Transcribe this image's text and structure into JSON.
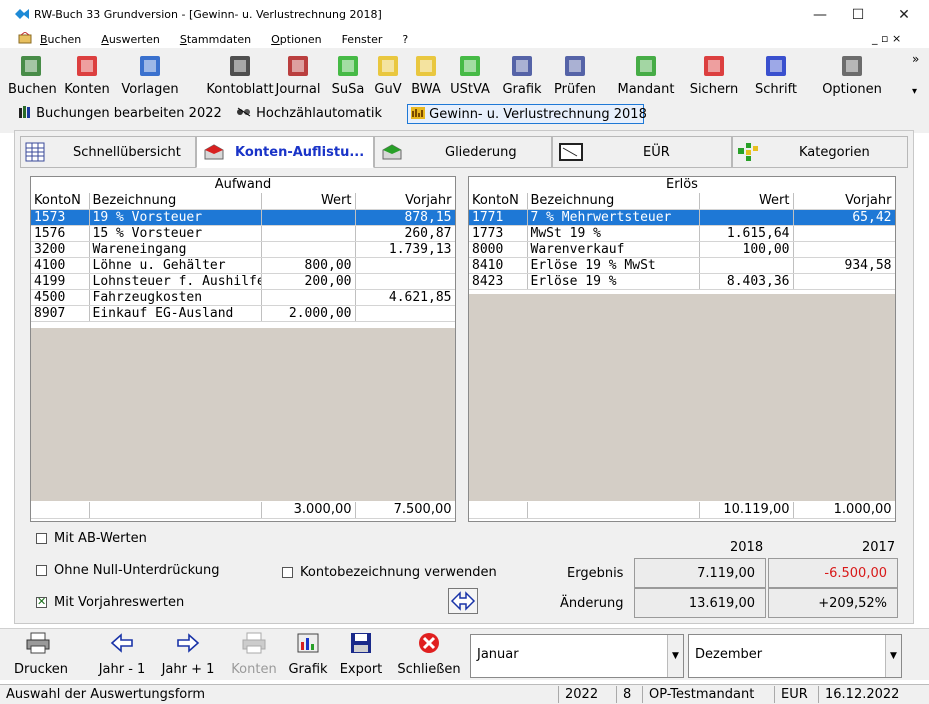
{
  "window": {
    "title": "RW-Buch 33 Grundversion  - [Gewinn- u. Verlustrechnung 2018]",
    "controls": {
      "minimize": "—",
      "maximize": "☐",
      "close": "✕"
    }
  },
  "menu": {
    "items": [
      "Buchen",
      "Auswerten",
      "Stammdaten",
      "Optionen",
      "Fenster",
      "?"
    ],
    "mdi_controls": "_ ▫ ×"
  },
  "toolbar": {
    "buttons": [
      "Buchen",
      "Konten",
      "Vorlagen",
      "Kontoblatt",
      "Journal",
      "SuSa",
      "GuV",
      "BWA",
      "UStVA",
      "Grafik",
      "Prüfen",
      "Mandant",
      "Sichern",
      "Schrift",
      "Optionen"
    ],
    "overflow": "»",
    "overflow_down": "▾"
  },
  "doc_tabs": {
    "items": [
      "Buchungen bearbeiten 2022",
      "Hochzählautomatik",
      "Gewinn- u. Verlustrechnung 2018"
    ],
    "active_index": 2
  },
  "view_tabs": {
    "items": [
      "Schnellübersicht",
      "Konten-Auflistu...",
      "Gliederung",
      "EÜR",
      "Kategorien"
    ],
    "active_index": 1
  },
  "aufwand": {
    "title": "Aufwand",
    "columns": [
      "KontoN",
      "Bezeichnung",
      "Wert",
      "Vorjahr"
    ],
    "rows": [
      [
        "1573",
        "19 % Vorsteuer",
        "",
        "878,15"
      ],
      [
        "1576",
        "15 % Vorsteuer",
        "",
        "260,87"
      ],
      [
        "3200",
        "Wareneingang",
        "",
        "1.739,13"
      ],
      [
        "4100",
        "Löhne u. Gehälter",
        "800,00",
        ""
      ],
      [
        "4199",
        "Lohnsteuer f. Aushilfen",
        "200,00",
        ""
      ],
      [
        "4500",
        "Fahrzeugkosten",
        "",
        "4.621,85"
      ],
      [
        "8907",
        "Einkauf EG-Ausland",
        "2.000,00",
        ""
      ]
    ],
    "selected_row": 0,
    "total_wert": "3.000,00",
    "total_vorjahr": "7.500,00"
  },
  "erloes": {
    "title": "Erlös",
    "columns": [
      "KontoN",
      "Bezeichnung",
      "Wert",
      "Vorjahr"
    ],
    "rows": [
      [
        "1771",
        "7 % Mehrwertsteuer",
        "",
        "65,42"
      ],
      [
        "1773",
        "MwSt 19 %",
        "1.615,64",
        ""
      ],
      [
        "8000",
        "Warenverkauf",
        "100,00",
        ""
      ],
      [
        "8410",
        "Erlöse 19 % MwSt",
        "",
        "934,58"
      ],
      [
        "8423",
        "Erlöse 19 %",
        "8.403,36",
        ""
      ]
    ],
    "selected_row": 0,
    "total_wert": "10.119,00",
    "total_vorjahr": "1.000,00"
  },
  "options": {
    "mit_ab_werten": {
      "label": "Mit AB-Werten",
      "checked": false
    },
    "ohne_null": {
      "label": "Ohne Null-Unterdrückung",
      "checked": false
    },
    "kontobezeichnung": {
      "label": "Kontobezeichnung verwenden",
      "checked": false
    },
    "mit_vorjahreswerten": {
      "label": "Mit Vorjahreswerten",
      "checked": true
    }
  },
  "result": {
    "year_current": "2018",
    "year_previous": "2017",
    "ergebnis_label": "Ergebnis",
    "ergebnis_current": "7.119,00",
    "ergebnis_previous": "-6.500,00",
    "aenderung_label": "Änderung",
    "aenderung_value": "13.619,00",
    "aenderung_percent": "+209,52%",
    "negative_color": "#d81818"
  },
  "bottom_toolbar": {
    "drucken": "Drucken",
    "jahr_minus": "Jahr - 1",
    "jahr_plus": "Jahr + 1",
    "konten": "Konten",
    "grafik": "Grafik",
    "export": "Export",
    "schliessen": "Schließen",
    "from_month": "Januar",
    "to_month": "Dezember"
  },
  "statusbar": {
    "hint": "Auswahl der Auswertungsform",
    "year": "2022",
    "period": "8",
    "mandant": "OP-Testmandant",
    "currency": "EUR",
    "date": "16.12.2022"
  },
  "colors": {
    "selection": "#1e78d6",
    "active_tab_text": "#1a34c8",
    "empty_area": "#d4cec6"
  }
}
